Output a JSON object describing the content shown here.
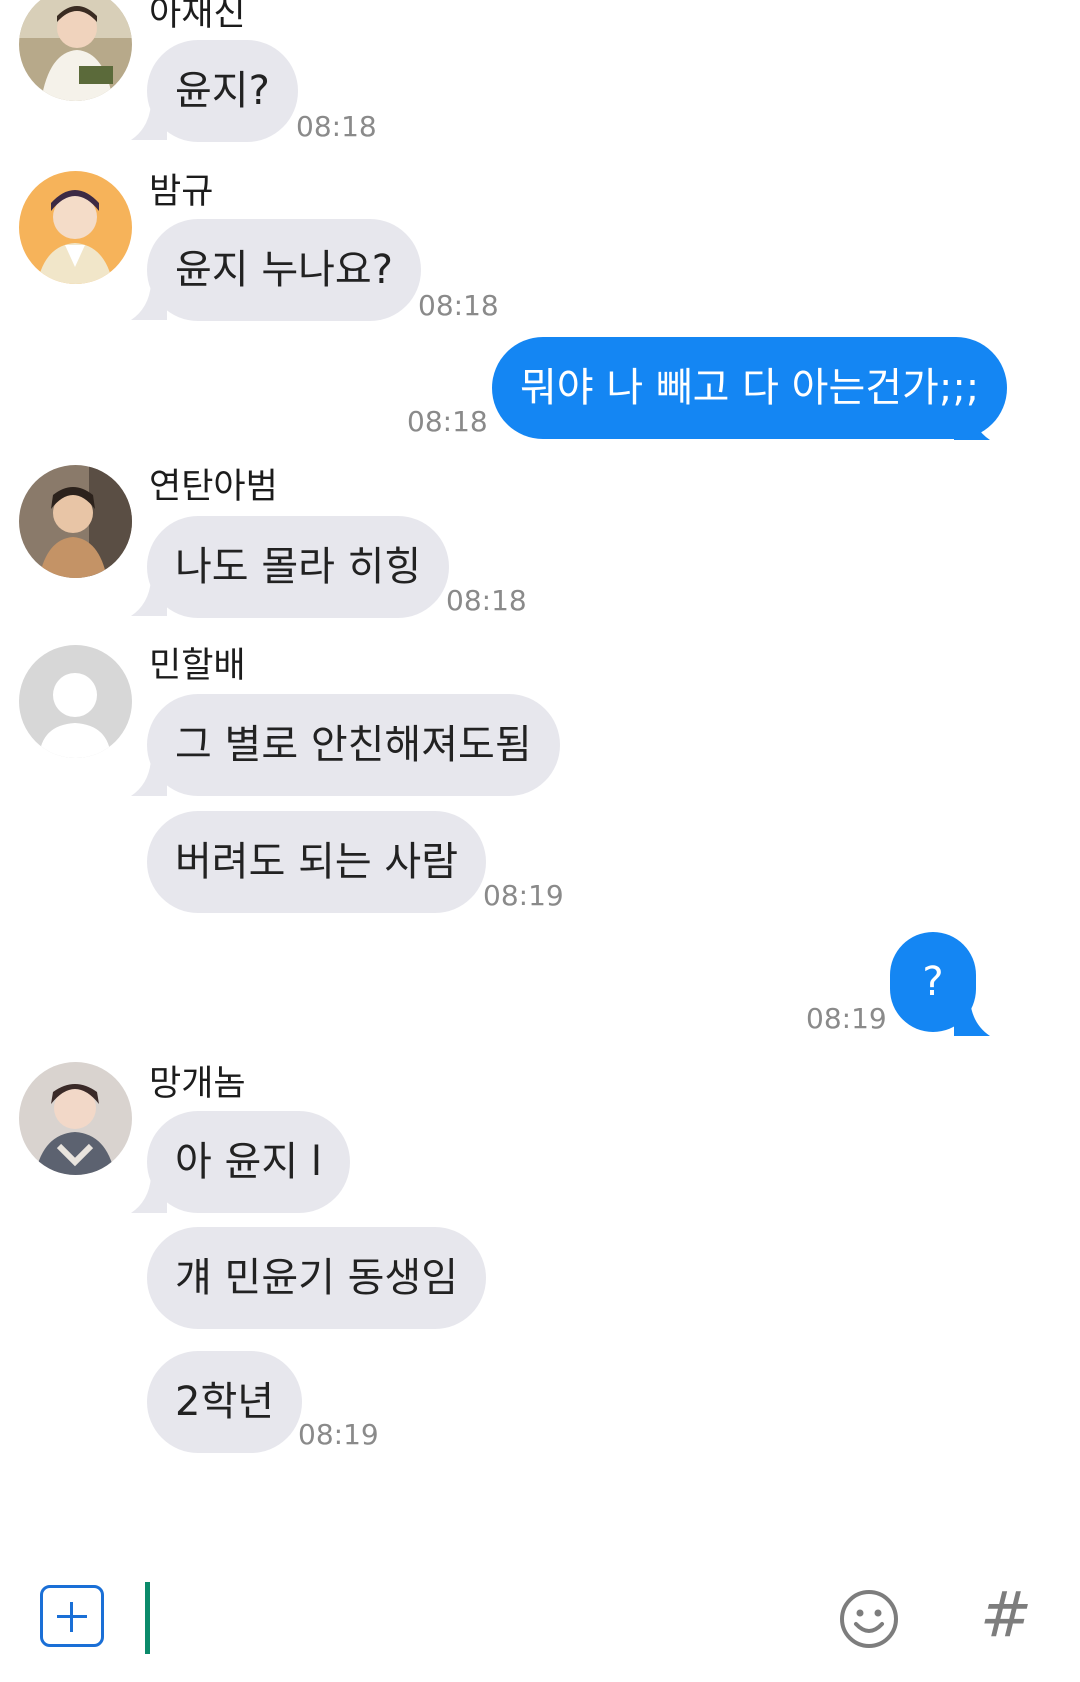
{
  "messages": [
    {
      "sender": "아재신",
      "lines": [
        "윤지?"
      ],
      "time": "08:18"
    },
    {
      "sender": "밤규",
      "lines": [
        "윤지 누나요?"
      ],
      "time": "08:18"
    },
    {
      "sender": "me",
      "lines": [
        "뭐야 나 빼고 다 아는건가;;;"
      ],
      "time": "08:18"
    },
    {
      "sender": "연탄아범",
      "lines": [
        "나도 몰라 히힝"
      ],
      "time": "08:18"
    },
    {
      "sender": "민할배",
      "lines": [
        "그 별로 안친해져도됨",
        "버려도 되는 사람"
      ],
      "time": "08:19"
    },
    {
      "sender": "me",
      "lines": [
        "?"
      ],
      "time": "08:19"
    },
    {
      "sender": "망개놈",
      "lines": [
        "아 윤지 l",
        "걔 민윤기 동생임",
        "2학년"
      ],
      "time": "08:19"
    }
  ],
  "composer": {
    "placeholder": "",
    "hash_label": "#"
  },
  "colors": {
    "outgoing": "#1486f3",
    "incoming": "#e7e7ed",
    "cursor": "#0b8a6a",
    "plus": "#1a6fd6"
  }
}
